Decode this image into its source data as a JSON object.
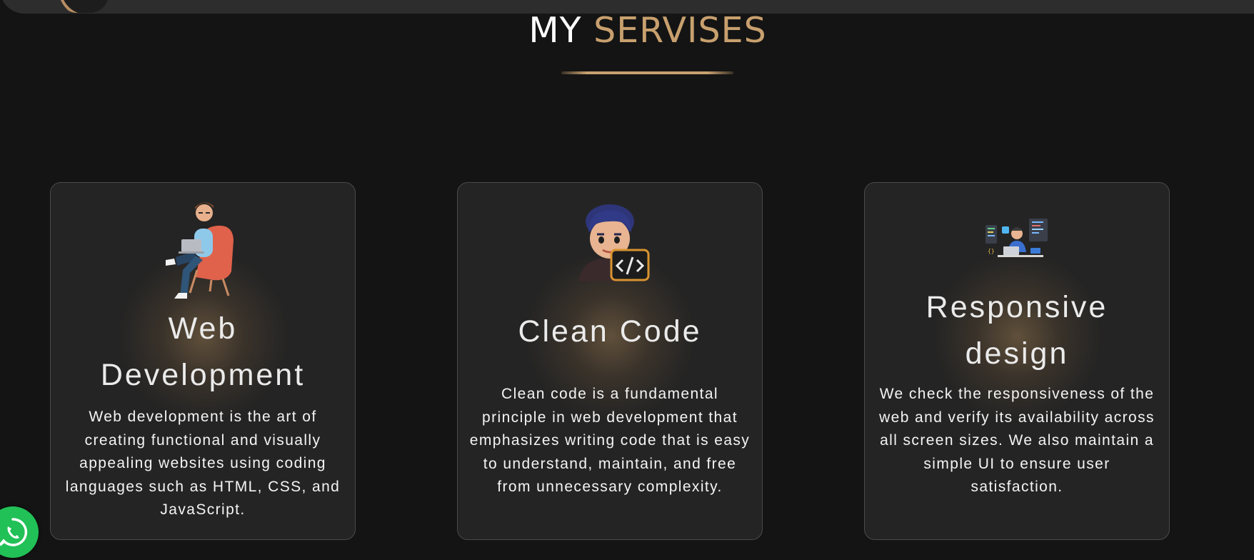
{
  "header": {
    "avatar_icon": "profile-avatar-icon"
  },
  "section": {
    "title_part1": "MY",
    "title_part2": "SERVISES"
  },
  "colors": {
    "accent": "#c8a06e",
    "background": "#141414",
    "card": "#242424",
    "whatsapp": "#21c157"
  },
  "cards": [
    {
      "title_line1": "Web",
      "title_line2": "Development",
      "text": "Web development is the art of creating functional and visually appealing websites using coding languages such as HTML, CSS, and JavaScript.",
      "icon": "developer-in-chair-illustration"
    },
    {
      "title": "Clean Code",
      "text": "Clean code is a fundamental principle in web development that emphasizes writing code that is easy to understand, maintain, and free from unnecessary complexity.",
      "icon": "coder-with-code-badge-illustration"
    },
    {
      "title_line1": "Responsive",
      "title_line2": "design",
      "text": "We check the responsiveness of the web and verify its availability across all screen sizes. We also maintain a simple UI to ensure user satisfaction.",
      "icon": "developer-at-desk-illustration"
    }
  ],
  "floating": {
    "whatsapp_icon": "whatsapp-icon"
  }
}
